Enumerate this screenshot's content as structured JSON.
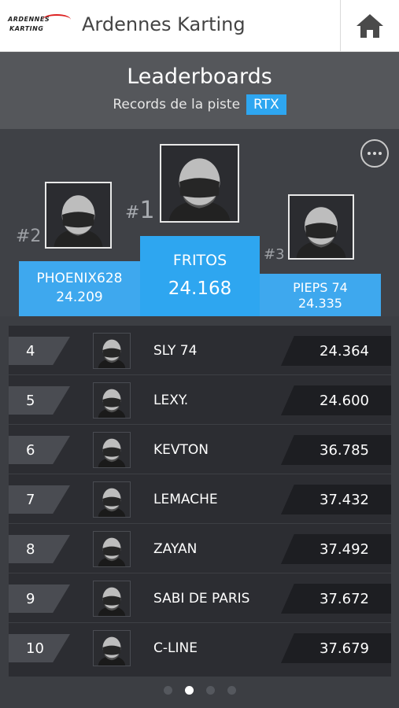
{
  "app": {
    "logo_line1": "ARDENNES",
    "logo_line2": "KARTING",
    "title": "Ardennes Karting",
    "home_icon": "home-icon"
  },
  "header": {
    "title": "Leaderboards",
    "subtitle": "Records de la piste",
    "badge": "RTX"
  },
  "podium": [
    {
      "rank_label": "#1",
      "name": "FRITOS",
      "time": "24.168"
    },
    {
      "rank_label": "#2",
      "name": "PHOENIX628",
      "time": "24.209"
    },
    {
      "rank_label": "#3",
      "name": "PIEPS 74",
      "time": "24.335"
    }
  ],
  "leaderboard": [
    {
      "rank": "4",
      "name": "SLY 74",
      "time": "24.364"
    },
    {
      "rank": "5",
      "name": "LEXY.",
      "time": "24.600"
    },
    {
      "rank": "6",
      "name": "KEVTON",
      "time": "36.785"
    },
    {
      "rank": "7",
      "name": "LEMACHE",
      "time": "37.432"
    },
    {
      "rank": "8",
      "name": "ZAYAN",
      "time": "37.492"
    },
    {
      "rank": "9",
      "name": "SABI DE PARIS",
      "time": "37.672"
    },
    {
      "rank": "10",
      "name": "C-LINE",
      "time": "37.679"
    }
  ],
  "pagination": {
    "count": 4,
    "active": 2
  },
  "colors": {
    "accent": "#2ea6f0",
    "background": "#3c3e43",
    "row": "#2c2d32"
  }
}
